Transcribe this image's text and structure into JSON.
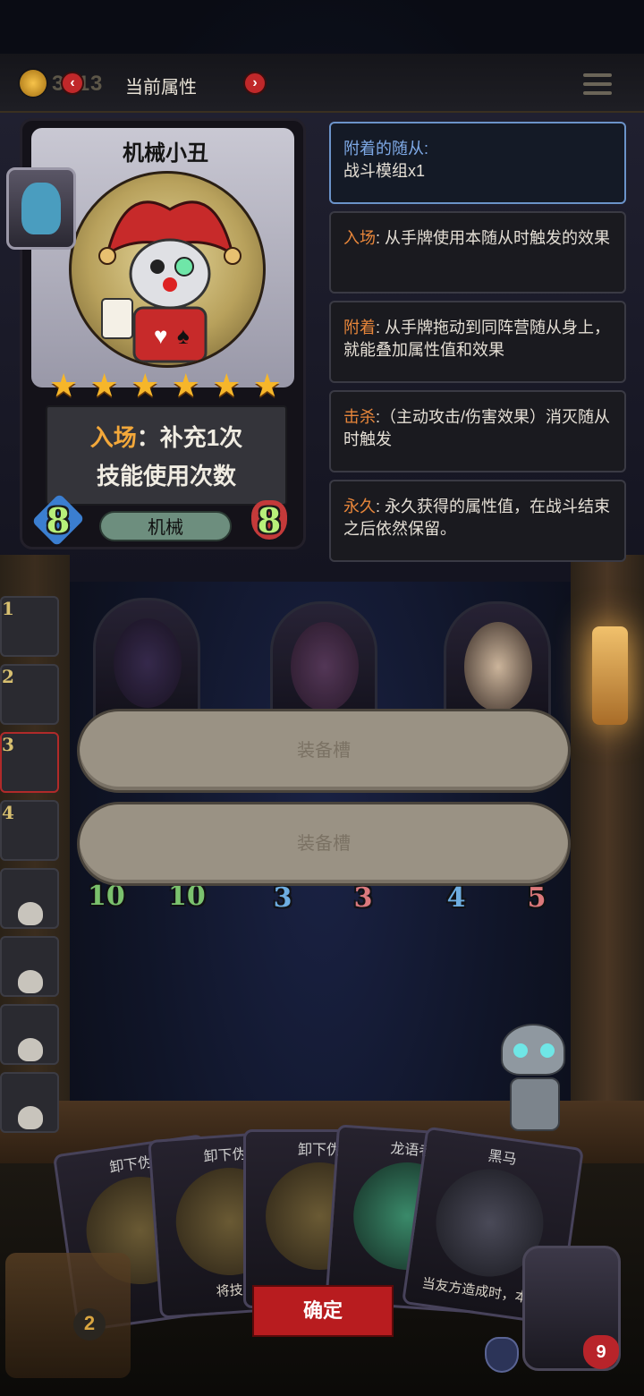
{
  "header": {
    "coin_amount": "3013",
    "title": "当前属性",
    "prev_arrow": "‹",
    "next_arrow": "›"
  },
  "card": {
    "name": "机械小丑",
    "stars": 6,
    "effect_keyword": "入场",
    "effect_rest": "：补充1次",
    "effect_line2": "技能使用次数",
    "attack": "8",
    "health": "8",
    "tribe": "机械"
  },
  "info_panels": [
    {
      "title": "附着的随从:",
      "body": "战斗模组x1"
    },
    {
      "keyword": "入场",
      "body": ": 从手牌使用本随从时触发的效果"
    },
    {
      "keyword": "附着",
      "body": ": 从手牌拖动到同阵营随从身上，就能叠加属性值和效果"
    },
    {
      "keyword": "击杀",
      "body": ":（主动攻击/伤害效果）消灭随从时触发"
    },
    {
      "keyword": "永久",
      "body": ": 永久获得的属性值，在战斗结束之后依然保留。"
    }
  ],
  "board_minions": [
    {
      "attack": "10",
      "health": "10"
    },
    {
      "attack": "3",
      "health": "3"
    },
    {
      "attack": "4",
      "health": "5"
    }
  ],
  "equip_slots": [
    "装备槽",
    "装备槽"
  ],
  "roster": [
    {
      "num": "1",
      "dead": false
    },
    {
      "num": "2",
      "dead": false
    },
    {
      "num": "3",
      "dead": false,
      "active": true
    },
    {
      "num": "4",
      "dead": false
    },
    {
      "num": "",
      "dead": true
    },
    {
      "num": "",
      "dead": true
    },
    {
      "num": "",
      "dead": true
    },
    {
      "num": "",
      "dead": true
    }
  ],
  "hand": [
    {
      "name": "卸下伪",
      "desc": ""
    },
    {
      "name": "卸下伪",
      "desc": "将技能"
    },
    {
      "name": "卸下伪",
      "desc": ""
    },
    {
      "name": "龙语者",
      "desc": ""
    },
    {
      "name": "黑马",
      "desc": "当友方造成时，本随"
    }
  ],
  "confirm_label": "确定",
  "chest_count": "2",
  "player_health": "9",
  "colors": {
    "accent_red": "#b81c1f",
    "keyword_orange": "#e8863a",
    "star_gold": "#f6b62a"
  }
}
